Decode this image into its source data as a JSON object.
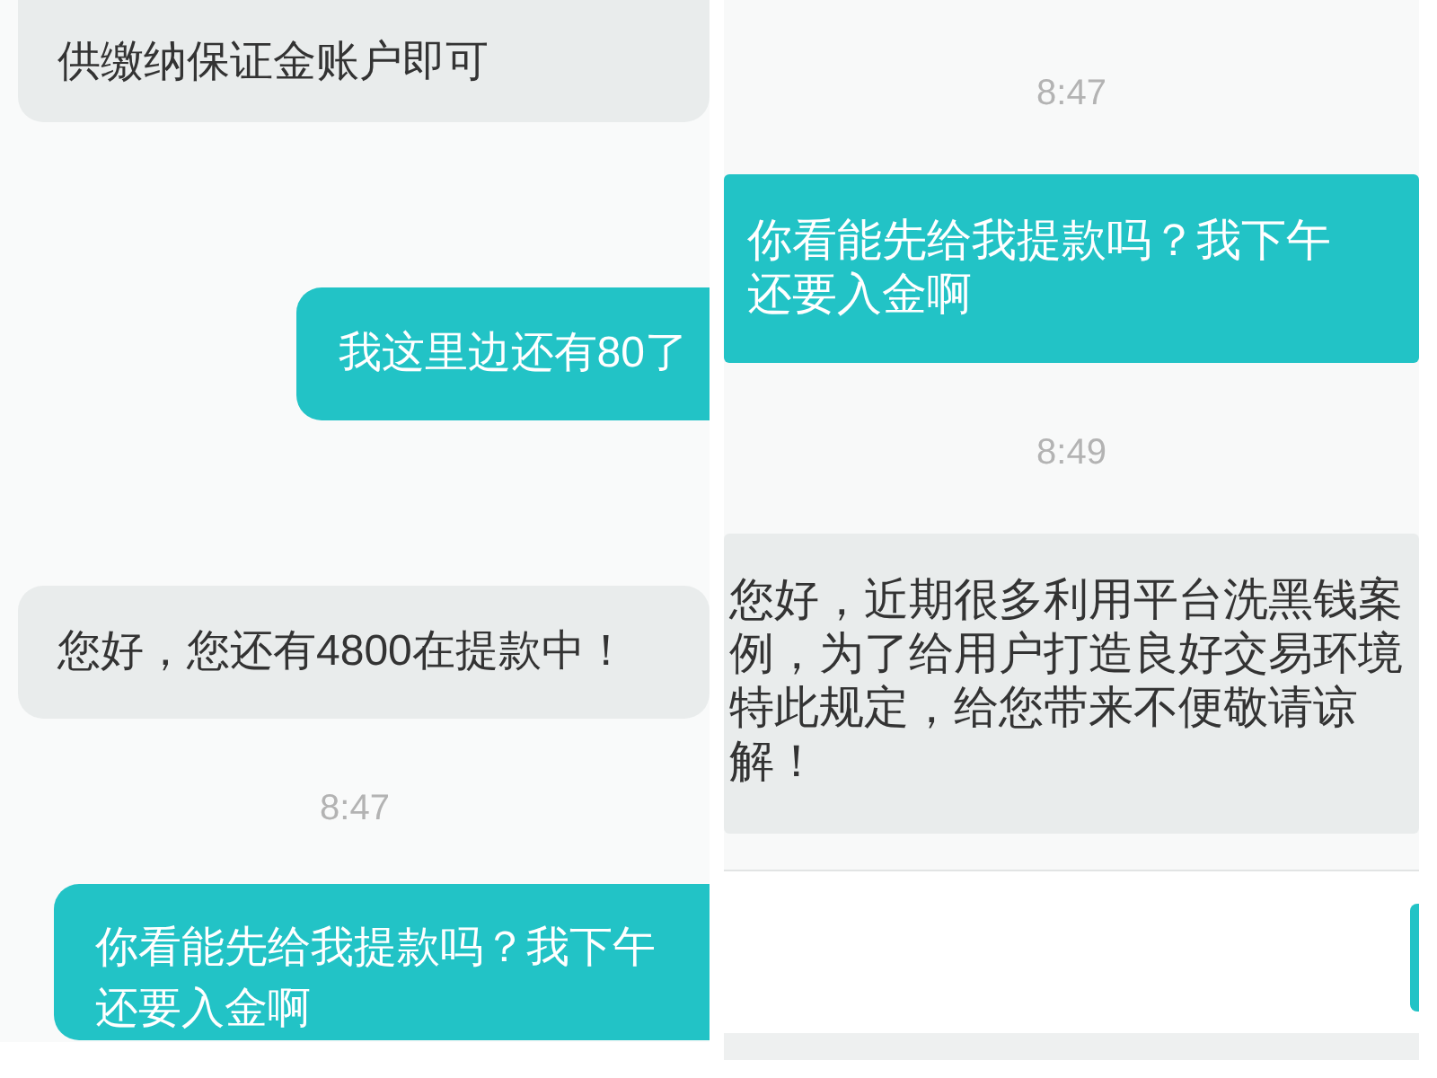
{
  "panels": [
    {
      "messages": [
        {
          "kind": "received",
          "text": "供缴纳保证金账户即可"
        },
        {
          "kind": "sent",
          "text": "我这里边还有80了"
        },
        {
          "kind": "received",
          "text": "您好，您还有4800在提款中！"
        },
        {
          "kind": "time",
          "text": "8:47"
        },
        {
          "kind": "sent",
          "text": "你看能先给我提款吗？我下午还要入金啊"
        }
      ]
    },
    {
      "messages": [
        {
          "kind": "time",
          "text": "8:47"
        },
        {
          "kind": "sent",
          "text": "你看能先给我提款吗？我下午还要入金啊"
        },
        {
          "kind": "time",
          "text": "8:49"
        },
        {
          "kind": "received",
          "text": "您好，近期很多利用平台洗黑钱案例，为了给用户打造良好交易环境特此规定，给您带来不便敬请谅解！"
        },
        {
          "kind": "composer"
        }
      ]
    }
  ]
}
